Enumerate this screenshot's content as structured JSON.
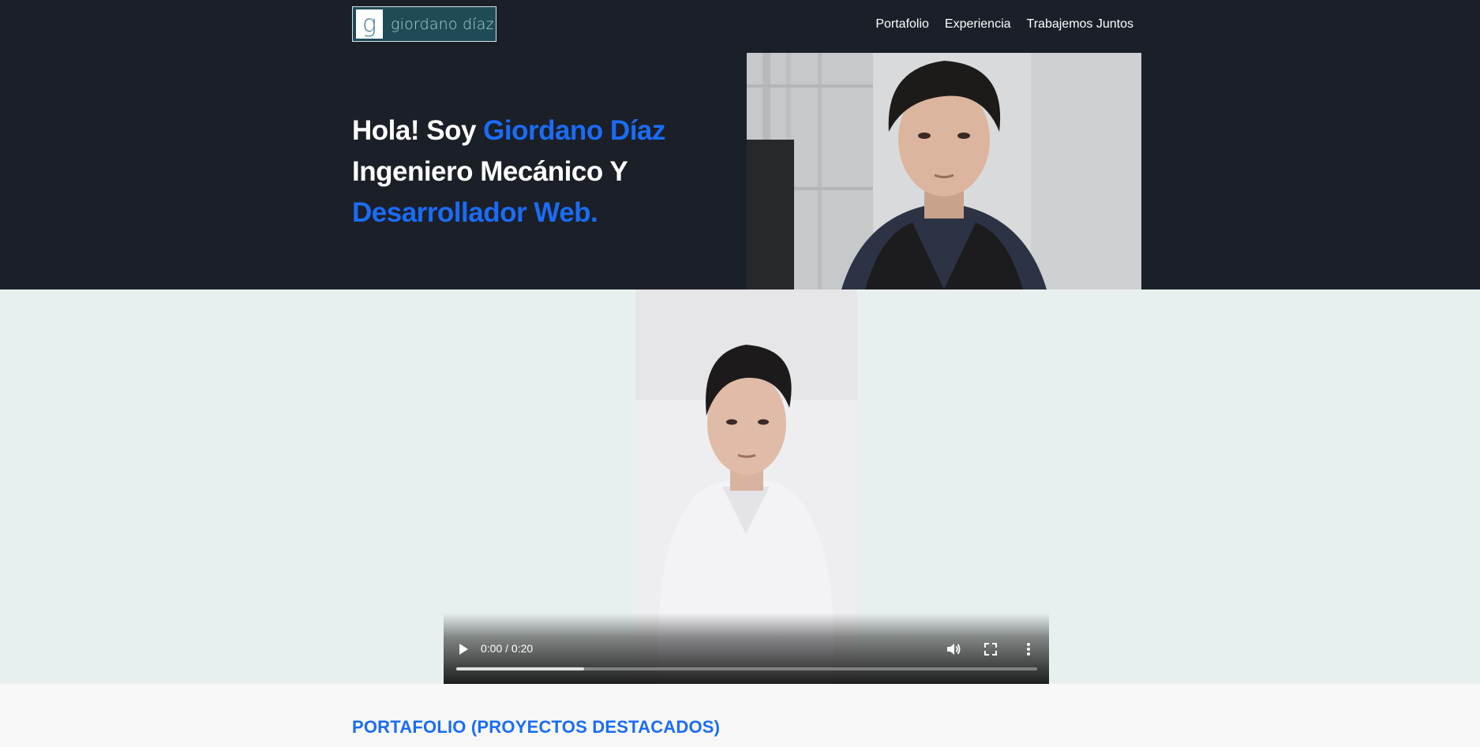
{
  "brand": {
    "logo_letter": "g",
    "logo_text": "giordano díaz"
  },
  "nav": {
    "items": [
      "Portafolio",
      "Experiencia",
      "Trabajemos Juntos"
    ]
  },
  "hero": {
    "line1_prefix": "Hola! Soy ",
    "line1_name": "Giordano Díaz",
    "line2": "Ingeniero Mecánico Y",
    "line3": "Desarrollador Web."
  },
  "video": {
    "time": "0:00 / 0:20",
    "buffered_fraction": 0.22
  },
  "portfolio": {
    "title": "PORTAFOLIO (PROYECTOS DESTACADOS)"
  },
  "colors": {
    "accent": "#1a6cf5",
    "header_bg": "#1b1f28",
    "video_band_bg": "#e8f0ef"
  }
}
